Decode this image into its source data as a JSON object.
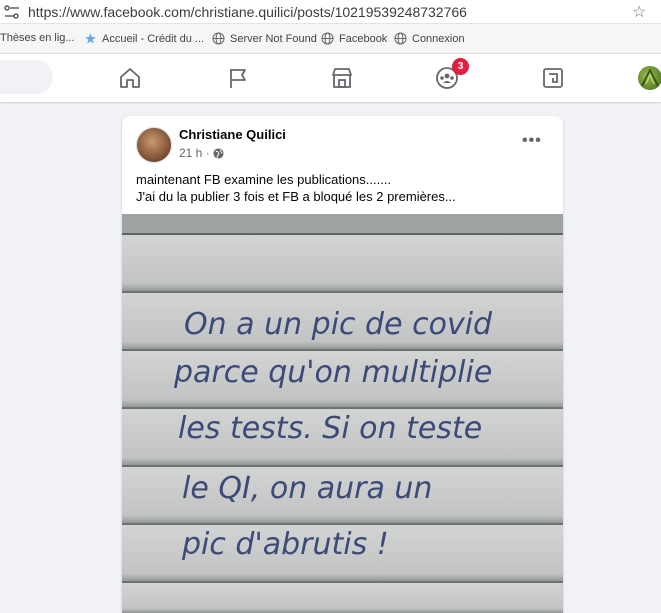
{
  "browser": {
    "url": "https://www.facebook.com/christiane.quilici/posts/10219539248732766",
    "bookmarks": [
      {
        "label": "Thèses en lig...",
        "icon": "none"
      },
      {
        "label": "Accueil - Crédit du ...",
        "icon": "star-icon"
      },
      {
        "label": "Server Not Found",
        "icon": "globe-icon"
      },
      {
        "label": "Facebook",
        "icon": "globe-icon"
      },
      {
        "label": "Connexion",
        "icon": "globe-icon"
      }
    ]
  },
  "nav": {
    "notification_count": "3",
    "icons": [
      "home-icon",
      "pages-flag-icon",
      "marketplace-icon",
      "groups-icon",
      "gaming-icon"
    ],
    "accent_color": "#1877f2"
  },
  "post": {
    "author": "Christiane Quilici",
    "time": "21 h ·",
    "text_line1": "maintenant FB  examine les publications.......",
    "text_line2": "J'ai du la publier 3 fois et FB a bloqué les 2 premières...",
    "photo_lines": [
      "On a un pic de covid",
      "parce qu'on multiplie",
      "les tests. Si on teste",
      "le QI, on aura un",
      "pic d'abrutis !"
    ]
  }
}
